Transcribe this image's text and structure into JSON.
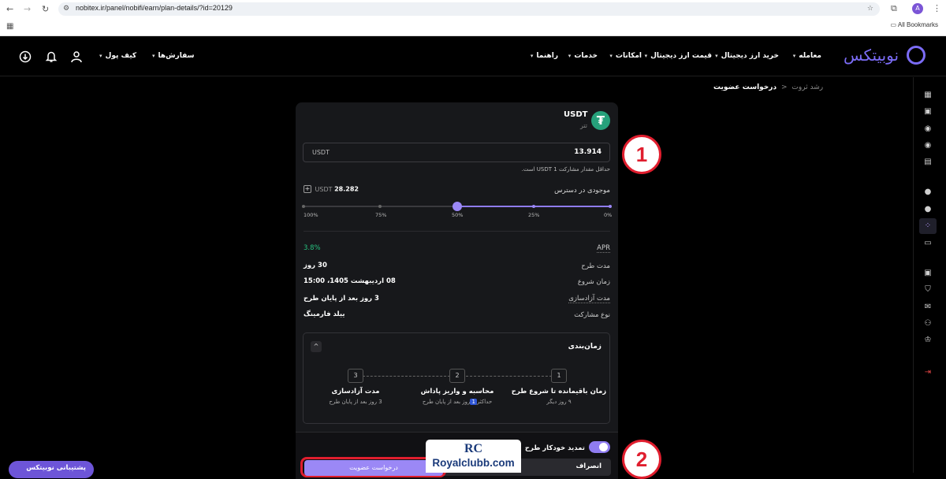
{
  "browser": {
    "url": "nobitex.ir/panel/nobifi/earn/plan-details/?id=20129",
    "avatar_letter": "A",
    "bookmarks_label": "All Bookmarks"
  },
  "header": {
    "logo_text": "نوبیتکس",
    "nav": [
      {
        "label": "معامله"
      },
      {
        "label": "خرید ارز دیجیتال"
      },
      {
        "label": "قیمت ارز دیجیتال"
      },
      {
        "label": "امکانات"
      },
      {
        "label": "خدمات"
      },
      {
        "label": "راهنما"
      }
    ],
    "wallet_label": "کیف پول",
    "orders_label": "سفارش‌ها"
  },
  "breadcrumb": {
    "parent": "رشد ثروت",
    "separator": "<",
    "current": "درخواست عضویت"
  },
  "card": {
    "coin_symbol": "USDT",
    "coin_name": "تتر",
    "coin_icon_glyph": "₮",
    "amount_unit": "USDT",
    "amount_value": "13.914",
    "min_note": "حداقل مقدار مشارکت 1 USDT است.",
    "available_label": "موجودی در دسترس",
    "available_plus": "+",
    "available_unit": "USDT",
    "available_value": "28.282",
    "slider": {
      "percent": 50,
      "labels": [
        "100%",
        "75%",
        "50%",
        "25%",
        "0%"
      ]
    },
    "details": [
      {
        "label": "APR",
        "value": "3.8%"
      },
      {
        "label": "مدت طرح",
        "value": "30 روز"
      },
      {
        "label": "زمان شروع",
        "value": "08 اردیبهشت 1405، 15:00"
      },
      {
        "label": "مدت آزادسازی",
        "value": "3 روز بعد از پایان طرح"
      },
      {
        "label": "نوع مشارکت",
        "value": "ییلد فارمینگ"
      }
    ],
    "timing": {
      "title": "زمان‌بندی",
      "toggle_glyph": "^",
      "steps": [
        {
          "num": "1",
          "title": "زمان باقیمانده تا شروع طرح",
          "sub": "۹ روز دیگر"
        },
        {
          "num": "2",
          "title": "محاسبه و واریز پاداش",
          "sub_before": "حداکثر",
          "sub_badge": "1",
          "sub_after": "روز بعد از پایان طرح"
        },
        {
          "num": "3",
          "title": "مدت آزادسازی",
          "sub": "3 روز بعد از پایان طرح"
        }
      ]
    },
    "auto_renew_label": "تمدید خودکار طرح",
    "cancel_label": "انصراف",
    "submit_label": "درخواست عضویت"
  },
  "annotations": {
    "marker_1": "1",
    "marker_2": "2"
  },
  "watermark": {
    "logo": "RC",
    "text": "Royalclubb.com"
  },
  "support_label": "پشتیبانی نوبیتکس",
  "colors": {
    "accent": "#8f7cf0",
    "apr_green": "#27c07e",
    "marker_red": "#e01e2e",
    "tether_green": "#26a17b"
  }
}
